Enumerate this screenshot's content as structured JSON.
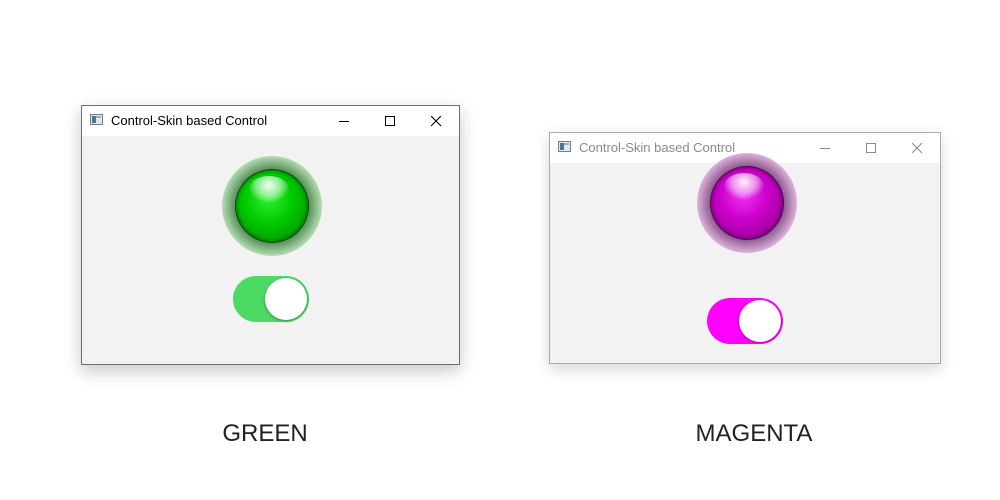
{
  "windows": [
    {
      "title": "Control-Skin based Control",
      "led_color": "green",
      "switch_on": true,
      "switch_color": "#4cd964",
      "state": "active"
    },
    {
      "title": "Control-Skin based Control",
      "led_color": "magenta",
      "switch_on": true,
      "switch_color": "#ff00ff",
      "state": "inactive"
    }
  ],
  "captions": [
    "GREEN",
    "MAGENTA"
  ],
  "icons": {
    "minimize": "minimize-icon",
    "maximize": "maximize-icon",
    "close": "close-icon",
    "app": "app-window-icon"
  }
}
